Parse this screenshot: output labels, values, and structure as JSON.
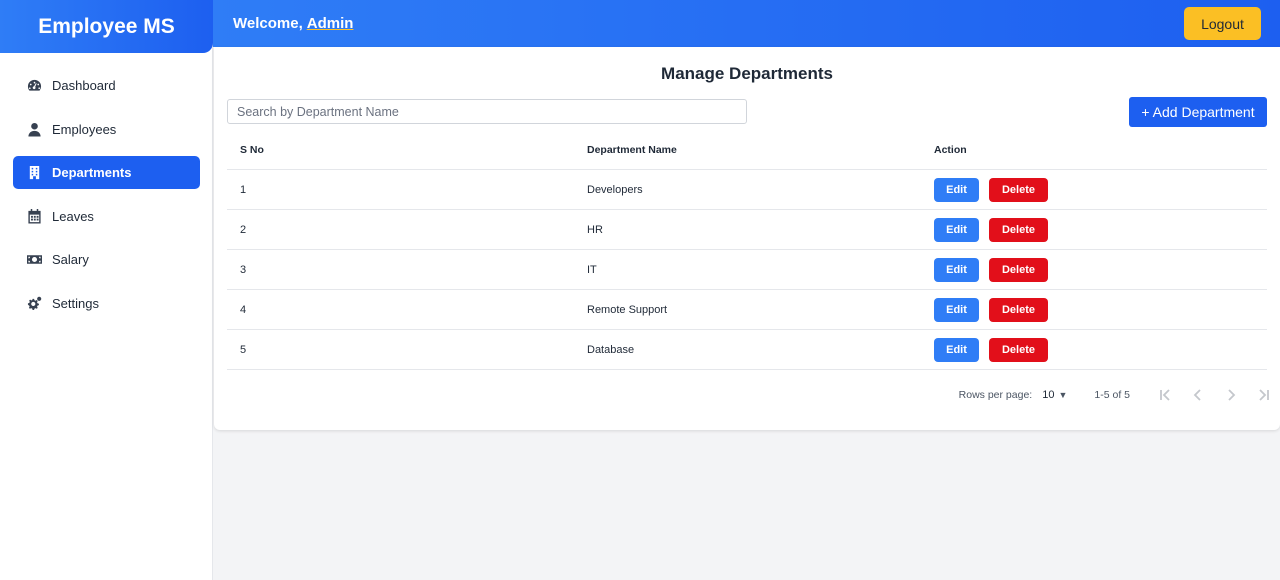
{
  "app": {
    "title": "Employee MS"
  },
  "sidebar": {
    "items": [
      {
        "label": "Dashboard",
        "icon": "gauge-icon"
      },
      {
        "label": "Employees",
        "icon": "user-icon"
      },
      {
        "label": "Departments",
        "icon": "building-icon",
        "active": true
      },
      {
        "label": "Leaves",
        "icon": "calendar-icon"
      },
      {
        "label": "Salary",
        "icon": "money-icon"
      },
      {
        "label": "Settings",
        "icon": "gears-icon"
      }
    ]
  },
  "header": {
    "welcome": "Welcome,",
    "user": "Admin",
    "logout_label": "Logout"
  },
  "main": {
    "title": "Manage Departments",
    "search_placeholder": "Search by Department Name",
    "add_label": "+ Add Department",
    "columns": [
      "S No",
      "Department Name",
      "Action"
    ],
    "rows": [
      {
        "sno": "1",
        "name": "Developers"
      },
      {
        "sno": "2",
        "name": "HR"
      },
      {
        "sno": "3",
        "name": "IT"
      },
      {
        "sno": "4",
        "name": "Remote Support"
      },
      {
        "sno": "5",
        "name": "Database"
      }
    ],
    "edit_label": "Edit",
    "delete_label": "Delete",
    "pagination": {
      "rows_per_page_label": "Rows per page:",
      "rows_per_page": "10",
      "range": "1-5 of 5"
    }
  },
  "colors": {
    "primary": "#1d5ff0",
    "accent": "#fbbf24",
    "danger": "#e20f1a",
    "edit": "#2f7df6"
  }
}
